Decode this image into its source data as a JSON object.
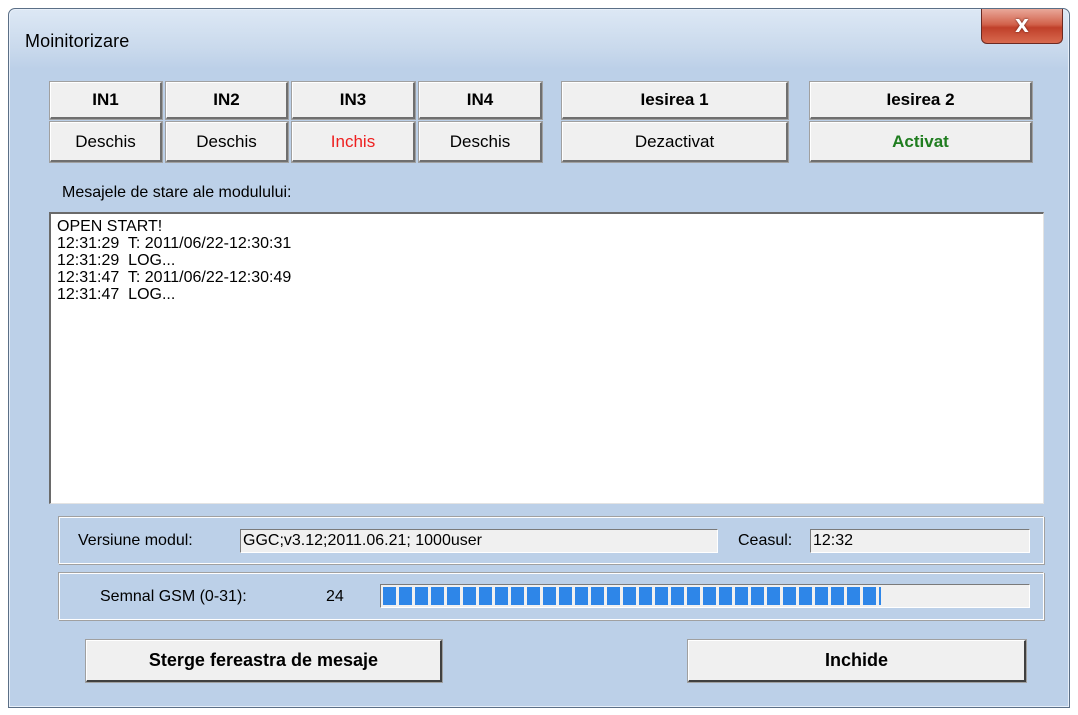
{
  "window": {
    "title": "Moinitorizare",
    "close_glyph": "X"
  },
  "status": {
    "headers": [
      "IN1",
      "IN2",
      "IN3",
      "IN4",
      "Iesirea 1",
      "Iesirea 2"
    ],
    "values": [
      "Deschis",
      "Deschis",
      "Inchis",
      "Deschis",
      "Dezactivat",
      "Activat"
    ],
    "colors": {
      "alarm": "#ee2020",
      "active": "#1f7d1f"
    }
  },
  "messages": {
    "label": "Mesajele de stare ale modulului:",
    "lines": [
      "OPEN START!",
      "12:31:29  T: 2011/06/22-12:30:31",
      "12:31:29  LOG...",
      "12:31:47  T: 2011/06/22-12:30:49",
      "12:31:47  LOG..."
    ]
  },
  "module": {
    "version_label": "Versiune modul:",
    "version_value": "GGC;v3.12;2011.06.21; 1000user",
    "clock_label": "Ceasul:",
    "clock_value": "12:32"
  },
  "gsm": {
    "label": "Semnal GSM (0-31):",
    "value": "24",
    "max": 31,
    "fill_fraction": 0.774,
    "bar_color": "#2e86e8"
  },
  "buttons": {
    "clear": "Sterge fereastra de mesaje",
    "close": "Inchide"
  }
}
